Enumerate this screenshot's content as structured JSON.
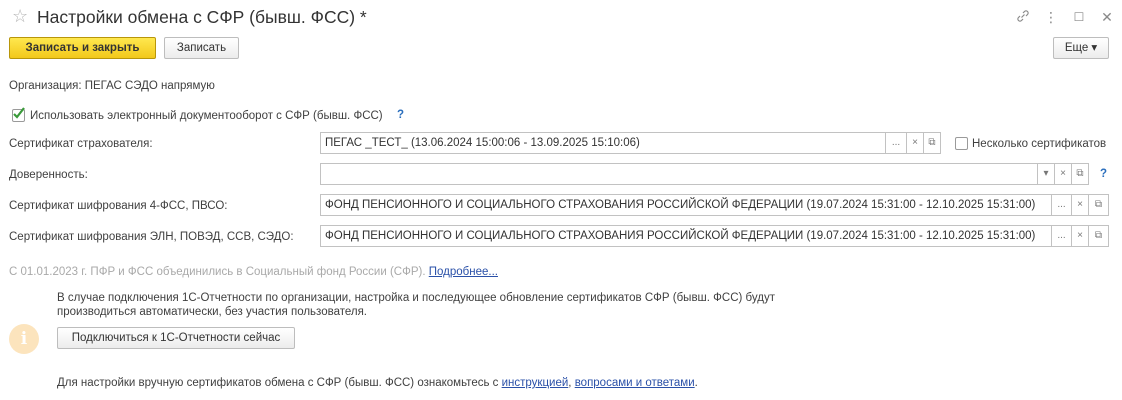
{
  "window": {
    "title": "Настройки обмена с СФР (бывш. ФСС) *",
    "star_icon": "☆",
    "link_icon": "🔗",
    "menu_icon": "⋮",
    "maximize_icon": "☐",
    "close_icon": "✕"
  },
  "toolbar": {
    "save_close_label": "Записать и закрыть",
    "save_label": "Записать",
    "more_label": "Еще ▾"
  },
  "organization": "Организация: ПЕГАС СЭДО напрямую",
  "use_edo": {
    "checked": true,
    "label": "Использовать электронный документооборот с СФР (бывш. ФСС)",
    "help": "?"
  },
  "fields": {
    "insurer_cert": {
      "label": "Сертификат страхователя:",
      "value": "ПЕГАС _ТЕСТ_ (13.06.2024 15:00:06 - 13.09.2025 15:10:06)"
    },
    "several_certs": {
      "checked": false,
      "label": "Несколько сертификатов"
    },
    "power_of_attorney": {
      "label": "Доверенность:",
      "value": "",
      "help": "?"
    },
    "enc_cert_4fss": {
      "label": "Сертификат шифрования 4-ФСС, ПВСО:",
      "value": "ФОНД ПЕНСИОННОГО И СОЦИАЛЬНОГО СТРАХОВАНИЯ РОССИЙСКОЙ ФЕДЕРАЦИИ (19.07.2024 15:31:00 - 12.10.2025 15:31:00)"
    },
    "enc_cert_eln": {
      "label": "Сертификат шифрования ЭЛН, ПОВЭД, ССВ, СЭДО:",
      "value": "ФОНД ПЕНСИОННОГО И СОЦИАЛЬНОГО СТРАХОВАНИЯ РОССИЙСКОЙ ФЕДЕРАЦИИ (19.07.2024 15:31:00 - 12.10.2025 15:31:00)"
    }
  },
  "field_buttons": {
    "select": "...",
    "clear": "×",
    "open": "⧉",
    "dropdown": "▾"
  },
  "notice": {
    "text": "С 01.01.2023 г. ПФР и ФСС объединились в Социальный фонд России (СФР).",
    "more_link": "Подробнее..."
  },
  "info": {
    "icon": "i",
    "line1": "В случае подключения 1С-Отчетности по организации, настройка и последующее обновление сертификатов СФР (бывш. ФСС) будут",
    "line2": "производиться автоматически, без участия пользователя.",
    "connect_button": "Подключиться к 1С-Отчетности сейчас"
  },
  "manual": {
    "prefix": "Для настройки вручную сертификатов обмена с СФР (бывш. ФСС) ознакомьтесь с",
    "instructions_link": "инструкцией",
    "comma": ",",
    "faq_link": "вопросами и ответами",
    "period": "."
  },
  "colors": {
    "primary_button": "#f2c81a",
    "link": "#2a50a8",
    "help": "#2a6ebd",
    "checkbox_check": "#3a9a3a"
  }
}
